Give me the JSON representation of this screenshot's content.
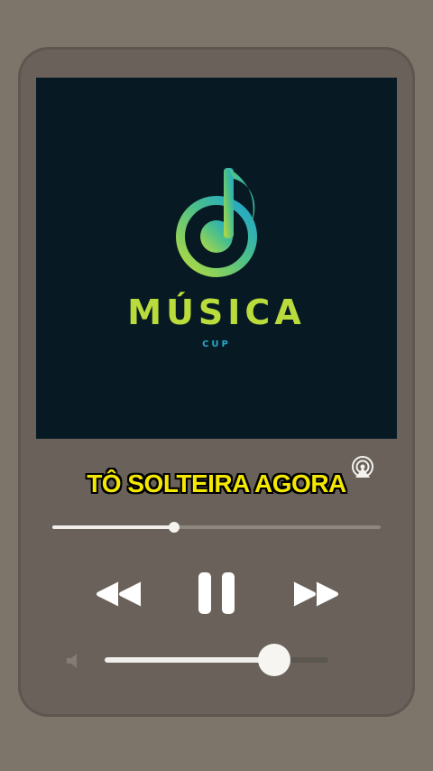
{
  "artwork": {
    "brand_name": "MÚSICA",
    "brand_sub": "CUP",
    "icon": "music-note-icon"
  },
  "lyric": "TÔ SOLTEIRA AGORA",
  "broadcast_icon": "airplay-icon",
  "progress": {
    "fraction": 0.37
  },
  "controls": {
    "rewind_icon": "rewind-icon",
    "pause_icon": "pause-icon",
    "forward_icon": "fast-forward-icon"
  },
  "volume": {
    "icon": "speaker-icon",
    "fraction": 0.76
  },
  "colors": {
    "background": "#7d756a",
    "panel": "#6a625a",
    "artwork_bg": "#071a24",
    "brand_green": "#b9dc3c",
    "brand_blue": "#26a8c9",
    "lyric": "#f4e700"
  }
}
